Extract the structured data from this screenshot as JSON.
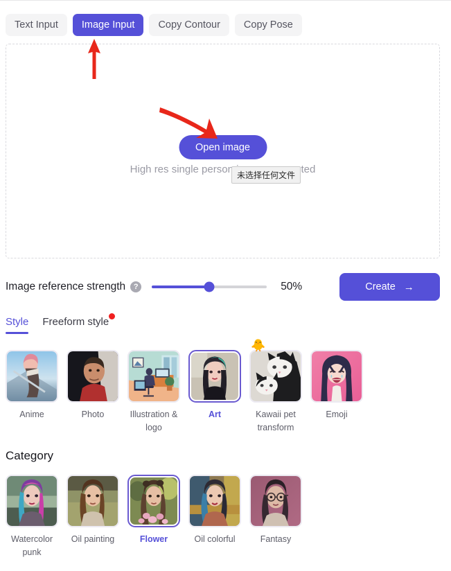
{
  "top_tabs": [
    {
      "label": "Text Input",
      "active": false
    },
    {
      "label": "Image Input",
      "active": true
    },
    {
      "label": "Copy Contour",
      "active": false
    },
    {
      "label": "Copy Pose",
      "active": false
    }
  ],
  "dropzone": {
    "open_button_label": "Open image",
    "hint_text": "High res single person image suggested",
    "tooltip_text": "未选择任何文件"
  },
  "strength": {
    "label": "Image reference strength",
    "help_icon": "question-mark-icon",
    "value_text": "50%",
    "value_percent": 50
  },
  "create": {
    "label": "Create",
    "arrow": "→"
  },
  "subtabs": [
    {
      "label": "Style",
      "active": true,
      "badge": false
    },
    {
      "label": "Freeform style",
      "active": false,
      "badge": true
    }
  ],
  "styles": [
    {
      "label": "Anime",
      "selected": false,
      "badge": ""
    },
    {
      "label": "Photo",
      "selected": false,
      "badge": ""
    },
    {
      "label": "Illustration & logo",
      "selected": false,
      "badge": ""
    },
    {
      "label": "Art",
      "selected": true,
      "badge": ""
    },
    {
      "label": "Kawaii pet transform",
      "selected": false,
      "badge": "🐥"
    },
    {
      "label": "Emoji",
      "selected": false,
      "badge": ""
    }
  ],
  "category": {
    "heading": "Category",
    "items": [
      {
        "label": "Watercolor punk",
        "selected": false
      },
      {
        "label": "Oil painting",
        "selected": false
      },
      {
        "label": "Flower",
        "selected": true
      },
      {
        "label": "Oil colorful",
        "selected": false
      },
      {
        "label": "Fantasy",
        "selected": false
      }
    ]
  },
  "colors": {
    "accent": "#5550d8",
    "accent_border": "#6a5ad0",
    "annotation_arrow": "#e8271a",
    "badge_red": "#f02020",
    "tab_inactive_bg": "#f4f4f5",
    "hint_text": "#9a9aa4"
  }
}
